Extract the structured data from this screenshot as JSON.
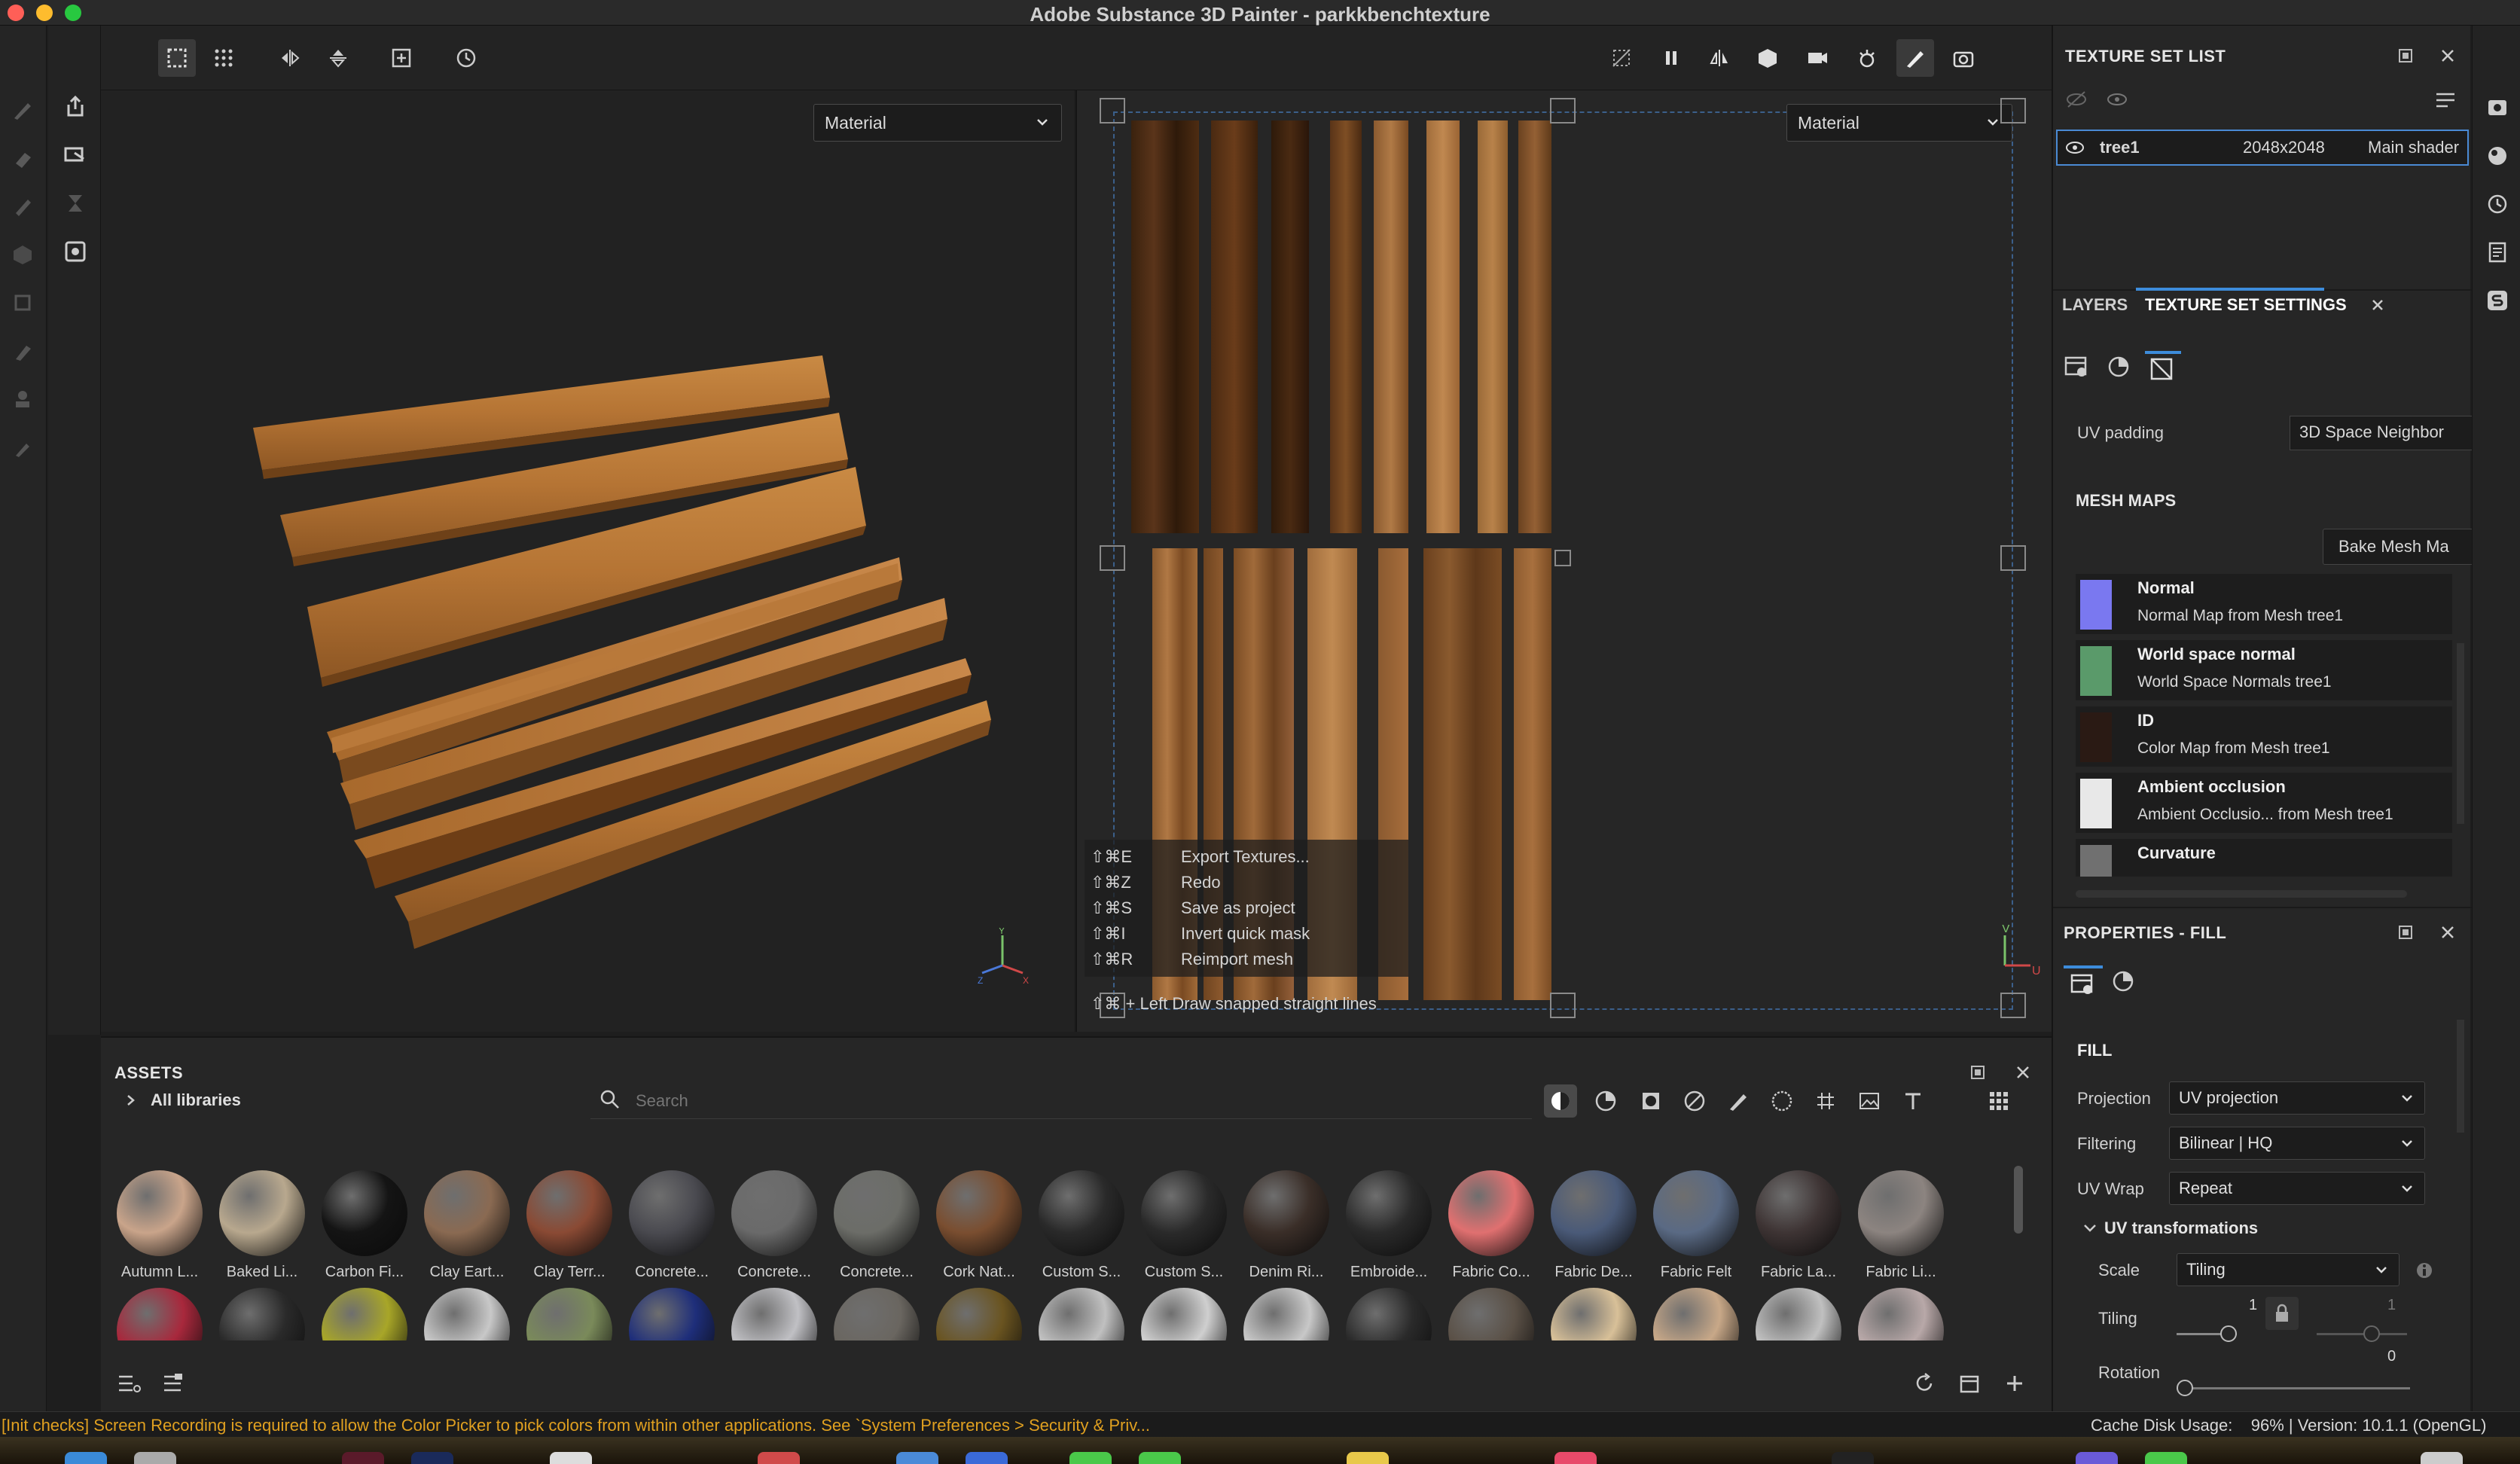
{
  "window": {
    "title": "Adobe Substance 3D Painter - parkkbenchtexture"
  },
  "viewport3d": {
    "mode_dropdown": "Material"
  },
  "viewport2d": {
    "mode_dropdown": "Material",
    "shortcuts": [
      {
        "key": "⇧⌘E",
        "action": "Export Textures..."
      },
      {
        "key": "⇧⌘Z",
        "action": "Redo"
      },
      {
        "key": "⇧⌘S",
        "action": "Save as project"
      },
      {
        "key": "⇧⌘I",
        "action": "Invert quick mask"
      },
      {
        "key": "⇧⌘R",
        "action": "Reimport mesh"
      }
    ],
    "snap_hint": "⇧⌘ + Left  Draw snapped straight lines",
    "axis_v": "V",
    "axis_u": "U"
  },
  "axis3d": {
    "y": "Y",
    "x": "X",
    "z": "Z"
  },
  "assets": {
    "title": "ASSETS",
    "libraries": "All libraries",
    "search_placeholder": "Search",
    "row1": [
      {
        "label": "Autumn L...",
        "color": "#c9a48a"
      },
      {
        "label": "Baked Li...",
        "color": "#b8a88e"
      },
      {
        "label": "Carbon Fi...",
        "color": "#141414"
      },
      {
        "label": "Clay Eart...",
        "color": "#8a6a52"
      },
      {
        "label": "Clay Terr...",
        "color": "#8a4a34"
      },
      {
        "label": "Concrete...",
        "color": "#4a4a50"
      },
      {
        "label": "Concrete...",
        "color": "#6a6a6a"
      },
      {
        "label": "Concrete...",
        "color": "#6c6d68"
      },
      {
        "label": "Cork Nat...",
        "color": "#7a4e30"
      },
      {
        "label": "Custom S...",
        "color": "#2a2a2a"
      },
      {
        "label": "Custom S...",
        "color": "#2a2a2a"
      },
      {
        "label": "Denim Ri...",
        "color": "#3a2e28"
      },
      {
        "label": "Embroide...",
        "color": "#2a2a2a"
      },
      {
        "label": "Fabric Co...",
        "color": "#e07070"
      },
      {
        "label": "Fabric De...",
        "color": "#4a5a78"
      },
      {
        "label": "Fabric Felt",
        "color": "#5a6a84"
      },
      {
        "label": "Fabric La...",
        "color": "#3e3434"
      },
      {
        "label": "Fabric Li...",
        "color": "#8c8480"
      }
    ],
    "row2_colors": [
      "#a8283c",
      "#2a2a2a",
      "#a8a628",
      "#c8c8c8",
      "#7a8a5a",
      "#1e2e7a",
      "#c0c0c4",
      "#6a6660",
      "#6a5420",
      "#c0c0c0",
      "#cfcfcf",
      "#c8c8c8",
      "#2a2a2a",
      "#5a5046",
      "#d8c098",
      "#c8a888",
      "#c0c0c0",
      "#b8a8a8"
    ]
  },
  "texture_set_list": {
    "title": "TEXTURE SET LIST",
    "row": {
      "name": "tree1",
      "size": "2048x2048",
      "shader": "Main shader"
    }
  },
  "tabs": {
    "layers": "LAYERS",
    "settings": "TEXTURE SET SETTINGS"
  },
  "settings": {
    "uv_padding_label": "UV padding",
    "uv_padding_value": "3D Space Neighbor",
    "mesh_maps_title": "MESH MAPS",
    "bake_button": "Bake Mesh Ma",
    "maps": [
      {
        "name": "Normal",
        "sub": "Normal Map from Mesh tree1",
        "color": "#7a78f0"
      },
      {
        "name": "World space normal",
        "sub": "World Space Normals tree1",
        "color": "#5a9a6a"
      },
      {
        "name": "ID",
        "sub": "Color Map from Mesh tree1",
        "color": "#2a1a14"
      },
      {
        "name": "Ambient occlusion",
        "sub": "Ambient Occlusio... from Mesh tree1",
        "color": "#e8e8e8"
      },
      {
        "name": "Curvature",
        "sub": "",
        "color": "#707070"
      }
    ]
  },
  "properties": {
    "title": "PROPERTIES - FILL",
    "section": "FILL",
    "projection_label": "Projection",
    "projection_value": "UV projection",
    "filtering_label": "Filtering",
    "filtering_value": "Bilinear | HQ",
    "wrap_label": "UV Wrap",
    "wrap_value": "Repeat",
    "uv_transform_title": "UV transformations",
    "scale_label": "Scale",
    "scale_value": "Tiling",
    "tiling_label": "Tiling",
    "tiling_value_1": "1",
    "tiling_value_2": "1",
    "rotation_label": "Rotation",
    "rotation_value": "0"
  },
  "status": {
    "message": "[Init checks] Screen Recording is required to allow the Color Picker to pick colors from within other applications. See `System Preferences > Security & Priv...",
    "cache": "Cache Disk Usage:    96% | Version: 10.1.1 (OpenGL)"
  },
  "colors": {
    "accent": "#3d8cdb",
    "status_warning": "#e0a020",
    "wood_light": "#b97a3a",
    "wood_dark": "#4a2a14"
  }
}
